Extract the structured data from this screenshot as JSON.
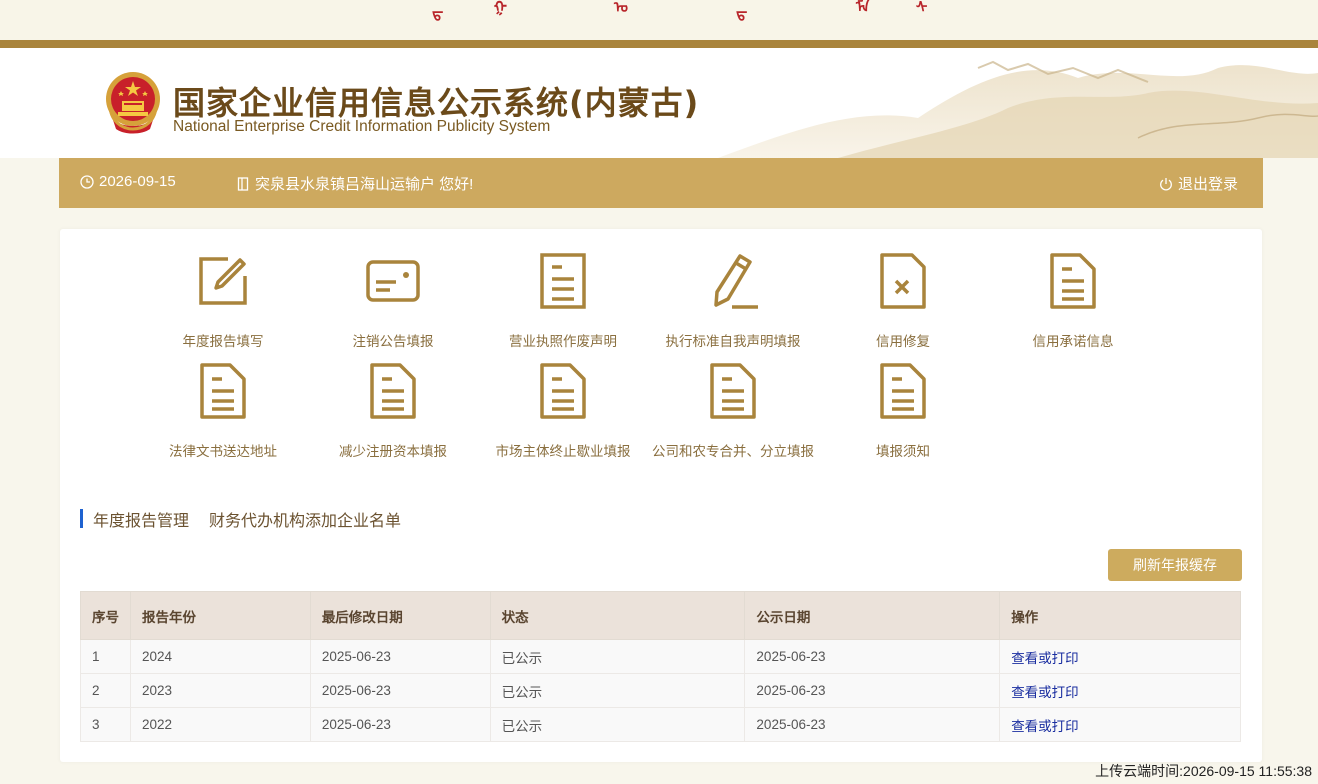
{
  "header": {
    "title_cn": "国家企业信用信息公示系统(内蒙古)",
    "title_en": "National Enterprise Credit Information Publicity System"
  },
  "topbar": {
    "date": "2026-09-15",
    "greeting": "突泉县水泉镇吕海山运输户 您好!",
    "logout_label": "退出登录"
  },
  "functions": [
    {
      "label": "年度报告填写",
      "icon": "edit-icon"
    },
    {
      "label": "注销公告填报",
      "icon": "id-card-icon"
    },
    {
      "label": "营业执照作废声明",
      "icon": "document-icon"
    },
    {
      "label": "执行标准自我声明填报",
      "icon": "pencil-icon"
    },
    {
      "label": "信用修复",
      "icon": "document-x-icon"
    },
    {
      "label": "信用承诺信息",
      "icon": "document-icon"
    },
    {
      "label": "法律文书送达地址",
      "icon": "document-icon"
    },
    {
      "label": "减少注册资本填报",
      "icon": "document-icon"
    },
    {
      "label": "市场主体终止歇业填报",
      "icon": "document-icon"
    },
    {
      "label": "公司和农专合并、分立填报",
      "icon": "document-icon"
    },
    {
      "label": "填报须知",
      "icon": "document-icon"
    }
  ],
  "tabs": [
    "年度报告管理",
    "财务代办机构添加企业名单"
  ],
  "refresh_label": "刷新年报缓存",
  "table": {
    "headers": [
      "序号",
      "报告年份",
      "最后修改日期",
      "状态",
      "公示日期",
      "操作"
    ],
    "rows": [
      {
        "no": "1",
        "year": "2024",
        "modified": "2025-06-23",
        "status": "已公示",
        "published": "2025-06-23",
        "action": "查看或打印"
      },
      {
        "no": "2",
        "year": "2023",
        "modified": "2025-06-23",
        "status": "已公示",
        "published": "2025-06-23",
        "action": "查看或打印"
      },
      {
        "no": "3",
        "year": "2022",
        "modified": "2025-06-23",
        "status": "已公示",
        "published": "2025-06-23",
        "action": "查看或打印"
      }
    ]
  },
  "upload_time": "上传云端时间:2026-09-15 11:55:38",
  "colors": {
    "gold": "#cda95f",
    "brown_bar": "#a9843c",
    "title_brown": "#6b4a1a",
    "link": "#1a2ea0",
    "tab_mark": "#1e62d0"
  }
}
